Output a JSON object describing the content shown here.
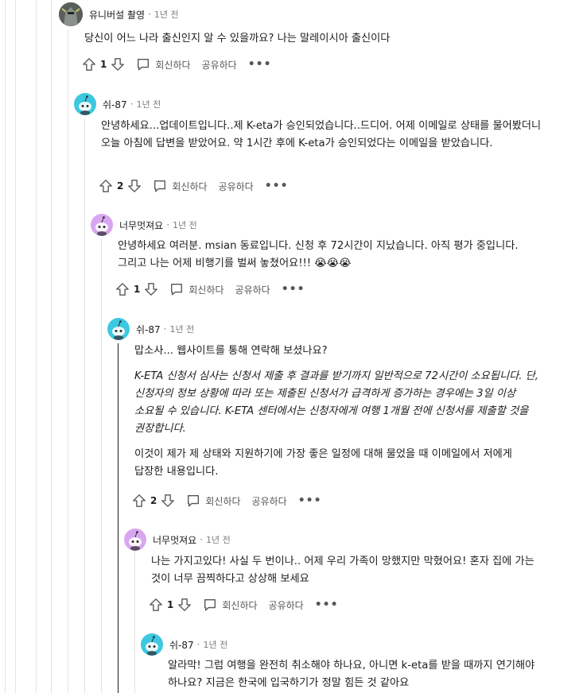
{
  "comments": [
    {
      "user": "유니버설 촬영",
      "time": "1년 전",
      "paragraphs": [
        "당신이 어느 나라 출신인지 알 수 있을까요? 나는 말레이시아 출신이다"
      ],
      "votes": "1",
      "reply": "회신하다",
      "share": "공유하다",
      "avatar": "knight-avatar"
    },
    {
      "user": "쉬-87",
      "time": "1년 전",
      "paragraphs": [
        "안녕하세요...업데이트입니다..제 K-eta가 승인되었습니다..드디어. 어제 이메일로 상태를 물어봤더니 오늘 아침에 답변을 받았어요. 약 1시간 후에 K-eta가 승인되었다는 이메일을 받았습니다."
      ],
      "votes": "2",
      "reply": "회신하다",
      "share": "공유하다",
      "avatar": "snoo-cyan"
    },
    {
      "user": "너무멋져요",
      "time": "1년 전",
      "paragraphs": [
        "안녕하세요 여러분. msian 동료입니다. 신청 후 72시간이 지났습니다. 아직 평가 중입니다. 그리고 나는 어제 비행기를 벌써 놓쳤어요!!! 😭😭😭"
      ],
      "votes": "1",
      "reply": "회신하다",
      "share": "공유하다",
      "avatar": "snoo-purple"
    },
    {
      "user": "쉬-87",
      "time": "1년 전",
      "paragraphs": [
        "맙소사... 웹사이트를 통해 연락해 보셨나요?",
        "K-ETA 신청서 심사는 신청서 제출 후 결과를 받기까지 일반적으로 72시간이 소요됩니다. 단, 신청자의 정보 상황에 따라 또는 제출된 신청서가 급격하게 증가하는 경우에는 3일 이상 소요될 수 있습니다. K-ETA 센터에서는 신청자에게 여행 1개월 전에 신청서를 제출할 것을 권장합니다.",
        "이것이 제가 제 상태와 지원하기에 가장 좋은 일정에 대해 물었을 때 이메일에서 저에게 답장한 내용입니다."
      ],
      "votes": "2",
      "reply": "회신하다",
      "share": "공유하다",
      "avatar": "snoo-cyan"
    },
    {
      "user": "너무멋져요",
      "time": "1년 전",
      "paragraphs": [
        "나는 가지고있다! 사실 두 번이나.. 어제 우리 가족이 망했지만 막혔어요! 혼자 집에 가는 것이 너무 끔찍하다고 상상해 보세요"
      ],
      "votes": "1",
      "reply": "회신하다",
      "share": "공유하다",
      "avatar": "snoo-purple"
    },
    {
      "user": "쉬-87",
      "time": "1년 전",
      "paragraphs": [
        "알라막! 그럼 여행을 완전히 취소해야 하나요, 아니면 k-eta를 받을 때까지 연기해야 하나요? 지금은 한국에 입국하기가 정말 힘든 것 같아요"
      ],
      "votes": "",
      "reply": "",
      "share": "",
      "avatar": "snoo-cyan"
    }
  ],
  "colors": {
    "cyan": "#3cc8e0",
    "purple": "#d8a6f0",
    "thread_line": "#e3e3e3",
    "active_line": "#1a1a1a",
    "meta": "#7c7c7c"
  }
}
